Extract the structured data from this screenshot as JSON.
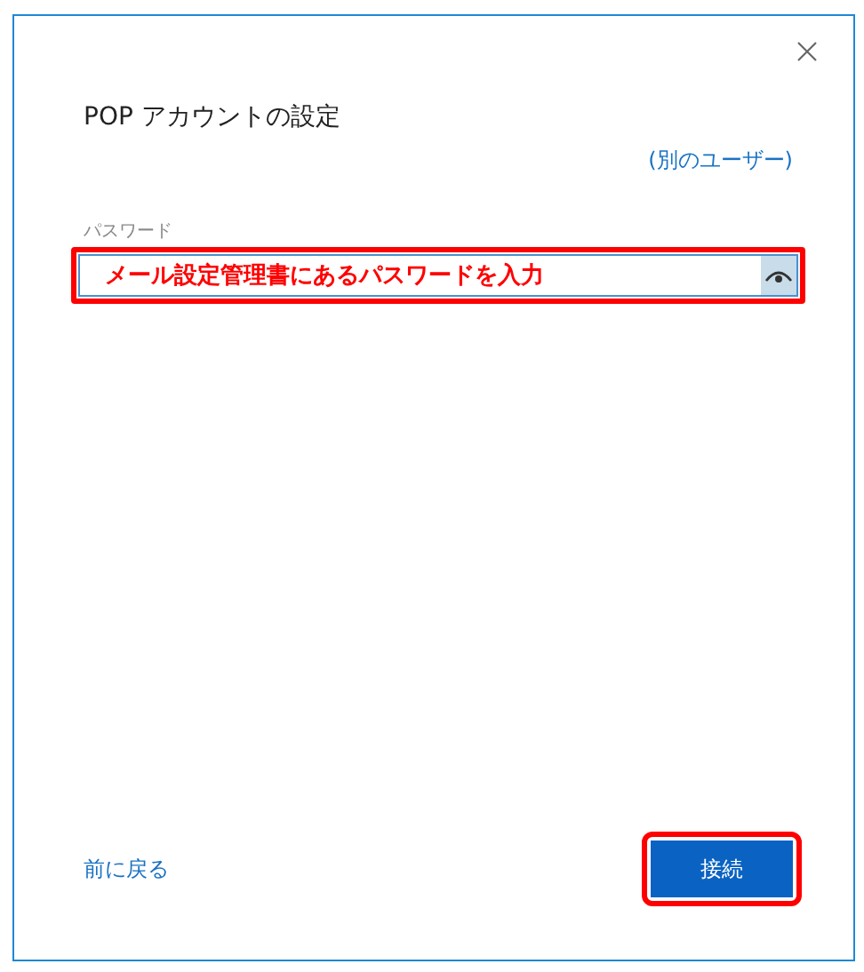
{
  "dialog": {
    "title": "POP アカウントの設定",
    "other_user_link": "(別のユーザー)",
    "password_field": {
      "label": "パスワード",
      "value": "メール設定管理書にあるパスワードを入力",
      "highlighted": true
    },
    "back_link": "前に戻る",
    "connect_button": {
      "label": "接続",
      "highlighted": true
    }
  }
}
